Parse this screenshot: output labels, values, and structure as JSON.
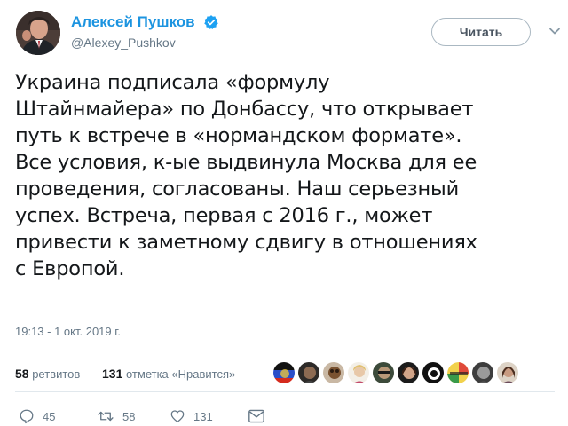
{
  "author": {
    "display_name": "Алексей Пушков",
    "handle": "@Alexey_Pushkov",
    "verified": true,
    "avatar_icon": "profile-photo"
  },
  "follow_button": {
    "label": "Читать"
  },
  "tweet": {
    "lines": [
      "Украина подписала «формулу",
      "Штайнмайера» по Донбассу, что открывает",
      "путь к встрече в «нормандском формате».",
      "Все условия, к-ые выдвинула Москва для ее",
      "проведения, согласованы. Наш серьезный",
      "успех. Встреча, первая с 2016 г., может",
      "привести к заметному сдвигу в отношениях",
      "с Европой."
    ],
    "timestamp": "19:13 - 1 окт. 2019 г."
  },
  "stats": {
    "retweets_count": "58",
    "retweets_label": "ретвитов",
    "likes_count": "131",
    "likes_label": "отметка «Нравится»"
  },
  "likers": [
    {
      "icon": "flag-avatar"
    },
    {
      "icon": "avatar"
    },
    {
      "icon": "avatar"
    },
    {
      "icon": "avatar"
    },
    {
      "icon": "avatar"
    },
    {
      "icon": "avatar"
    },
    {
      "icon": "avatar"
    },
    {
      "icon": "avatar"
    },
    {
      "icon": "avatar"
    },
    {
      "icon": "avatar"
    }
  ],
  "actions": {
    "reply_count": "45",
    "retweet_count": "58",
    "like_count": "131"
  },
  "colors": {
    "name_blue": "#1c94e0",
    "muted_gray": "#657786",
    "text_dark": "#14171a",
    "divider": "#e1e8ed"
  }
}
